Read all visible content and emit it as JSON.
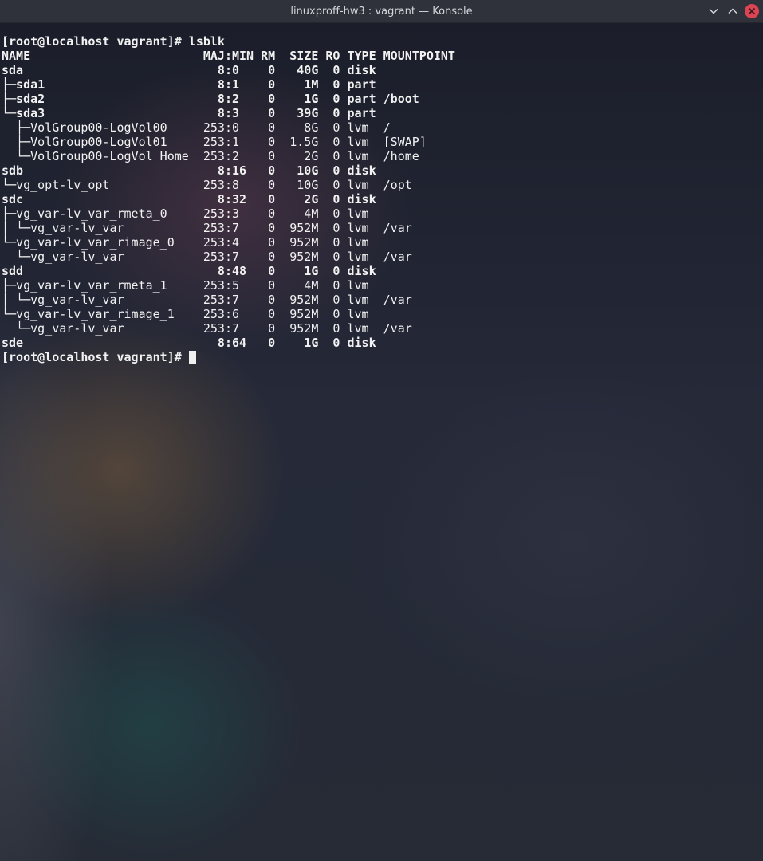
{
  "window": {
    "title": "linuxproff-hw3 : vagrant — Konsole",
    "buttons": {
      "minimize": "chevron-down-icon",
      "maximize": "chevron-up-icon",
      "close": "close-icon"
    },
    "colors": {
      "close_button": "#da4453",
      "title_text": "#d3d6db"
    }
  },
  "terminal": {
    "lines": [
      "[root@localhost vagrant]# lsblk",
      "NAME                        MAJ:MIN RM  SIZE RO TYPE MOUNTPOINT",
      "sda                           8:0    0   40G  0 disk",
      "├─sda1                        8:1    0    1M  0 part",
      "├─sda2                        8:2    0    1G  0 part /boot",
      "└─sda3                        8:3    0   39G  0 part",
      "  ├─VolGroup00-LogVol00     253:0    0    8G  0 lvm  /",
      "  ├─VolGroup00-LogVol01     253:1    0  1.5G  0 lvm  [SWAP]",
      "  └─VolGroup00-LogVol_Home  253:2    0    2G  0 lvm  /home",
      "sdb                           8:16   0   10G  0 disk",
      "└─vg_opt-lv_opt             253:8    0   10G  0 lvm  /opt",
      "sdc                           8:32   0    2G  0 disk",
      "├─vg_var-lv_var_rmeta_0     253:3    0    4M  0 lvm",
      "│ └─vg_var-lv_var           253:7    0  952M  0 lvm  /var",
      "└─vg_var-lv_var_rimage_0    253:4    0  952M  0 lvm",
      "  └─vg_var-lv_var           253:7    0  952M  0 lvm  /var",
      "sdd                           8:48   0    1G  0 disk",
      "├─vg_var-lv_var_rmeta_1     253:5    0    4M  0 lvm",
      "│ └─vg_var-lv_var           253:7    0  952M  0 lvm  /var",
      "└─vg_var-lv_var_rimage_1    253:6    0  952M  0 lvm",
      "  └─vg_var-lv_var           253:7    0  952M  0 lvm  /var",
      "sde                           8:64   0    1G  0 disk"
    ],
    "prompt": "[root@localhost vagrant]# "
  }
}
